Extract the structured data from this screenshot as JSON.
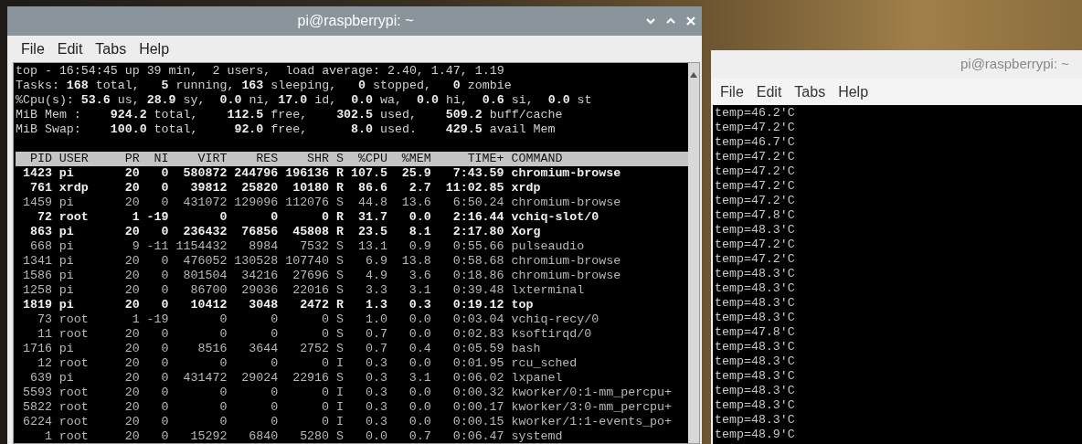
{
  "top_window": {
    "title": "pi@raspberrypi: ~",
    "active": true,
    "menu": [
      "File",
      "Edit",
      "Tabs",
      "Help"
    ],
    "summary_lines": [
      "top - 16:54:45 up 39 min,  2 users,  load average: 2.40, 1.47, 1.19",
      "Tasks: **168** total,   **5** running, **163** sleeping,   **0** stopped,   **0** zombie",
      "%Cpu(s): **53.6** us, **28.9** sy,  **0.0** ni, **17.0** id,  **0.0** wa,  **0.0** hi,  **0.6** si,  **0.0** st",
      "MiB Mem :    **924.2** total,    **112.5** free,    **302.5** used,    **509.2** buff/cache",
      "MiB Swap:    **100.0** total,     **92.0** free,      **8.0** used.    **429.5** avail Mem"
    ],
    "process_table": {
      "columns": [
        "PID",
        "USER",
        "PR",
        "NI",
        "VIRT",
        "RES",
        "SHR",
        "S",
        "%CPU",
        "%MEM",
        "TIME+",
        "COMMAND"
      ],
      "rows": [
        {
          "bold": true,
          "cells": [
            "1423",
            "pi",
            "20",
            "0",
            "580872",
            "244796",
            "196136",
            "R",
            "107.5",
            "25.9",
            "7:43.59",
            "chromium-browse"
          ]
        },
        {
          "bold": true,
          "cells": [
            "761",
            "xrdp",
            "20",
            "0",
            "39812",
            "25820",
            "10180",
            "R",
            "86.6",
            "2.7",
            "11:02.85",
            "xrdp"
          ]
        },
        {
          "bold": false,
          "cells": [
            "1459",
            "pi",
            "20",
            "0",
            "431072",
            "129096",
            "112076",
            "S",
            "44.8",
            "13.6",
            "6:50.24",
            "chromium-browse"
          ]
        },
        {
          "bold": true,
          "cells": [
            "72",
            "root",
            "1",
            "-19",
            "0",
            "0",
            "0",
            "R",
            "31.7",
            "0.0",
            "2:16.44",
            "vchiq-slot/0"
          ]
        },
        {
          "bold": true,
          "cells": [
            "863",
            "pi",
            "20",
            "0",
            "236432",
            "76856",
            "45808",
            "R",
            "23.5",
            "8.1",
            "2:17.80",
            "Xorg"
          ]
        },
        {
          "bold": false,
          "cells": [
            "668",
            "pi",
            "9",
            "-11",
            "1154432",
            "8984",
            "7532",
            "S",
            "13.1",
            "0.9",
            "0:55.66",
            "pulseaudio"
          ]
        },
        {
          "bold": false,
          "cells": [
            "1341",
            "pi",
            "20",
            "0",
            "476052",
            "130528",
            "107740",
            "S",
            "6.9",
            "13.8",
            "0:58.68",
            "chromium-browse"
          ]
        },
        {
          "bold": false,
          "cells": [
            "1586",
            "pi",
            "20",
            "0",
            "801504",
            "34216",
            "27696",
            "S",
            "4.9",
            "3.6",
            "0:18.86",
            "chromium-browse"
          ]
        },
        {
          "bold": false,
          "cells": [
            "1258",
            "pi",
            "20",
            "0",
            "86700",
            "29036",
            "22016",
            "S",
            "3.3",
            "3.1",
            "0:39.48",
            "lxterminal"
          ]
        },
        {
          "bold": true,
          "cells": [
            "1819",
            "pi",
            "20",
            "0",
            "10412",
            "3048",
            "2472",
            "R",
            "1.3",
            "0.3",
            "0:19.12",
            "top"
          ]
        },
        {
          "bold": false,
          "cells": [
            "73",
            "root",
            "1",
            "-19",
            "0",
            "0",
            "0",
            "S",
            "1.0",
            "0.0",
            "0:03.04",
            "vchiq-recy/0"
          ]
        },
        {
          "bold": false,
          "cells": [
            "11",
            "root",
            "20",
            "0",
            "0",
            "0",
            "0",
            "S",
            "0.7",
            "0.0",
            "0:02.83",
            "ksoftirqd/0"
          ]
        },
        {
          "bold": false,
          "cells": [
            "1716",
            "pi",
            "20",
            "0",
            "8516",
            "3644",
            "2752",
            "S",
            "0.7",
            "0.4",
            "0:05.59",
            "bash"
          ]
        },
        {
          "bold": false,
          "cells": [
            "12",
            "root",
            "20",
            "0",
            "0",
            "0",
            "0",
            "I",
            "0.3",
            "0.0",
            "0:01.95",
            "rcu_sched"
          ]
        },
        {
          "bold": false,
          "cells": [
            "639",
            "pi",
            "20",
            "0",
            "431472",
            "29024",
            "22916",
            "S",
            "0.3",
            "3.1",
            "0:06.02",
            "lxpanel"
          ]
        },
        {
          "bold": false,
          "cells": [
            "5593",
            "root",
            "20",
            "0",
            "0",
            "0",
            "0",
            "I",
            "0.3",
            "0.0",
            "0:00.32",
            "kworker/0:1-mm_percpu+"
          ]
        },
        {
          "bold": false,
          "cells": [
            "5822",
            "root",
            "20",
            "0",
            "0",
            "0",
            "0",
            "I",
            "0.3",
            "0.0",
            "0:00.17",
            "kworker/3:0-mm_percpu+"
          ]
        },
        {
          "bold": false,
          "cells": [
            "6224",
            "root",
            "20",
            "0",
            "0",
            "0",
            "0",
            "I",
            "0.3",
            "0.0",
            "0:00.15",
            "kworker/1:1-events_po+"
          ]
        },
        {
          "bold": false,
          "cells": [
            "1",
            "root",
            "20",
            "0",
            "15292",
            "6840",
            "5280",
            "S",
            "0.0",
            "0.7",
            "0:06.47",
            "systemd"
          ]
        }
      ]
    }
  },
  "temp_window": {
    "title": "pi@raspberrypi: ~",
    "active": false,
    "menu": [
      "File",
      "Edit",
      "Tabs",
      "Help"
    ],
    "lines": [
      "temp=46.2'C",
      "temp=47.2'C",
      "temp=46.7'C",
      "temp=47.2'C",
      "temp=47.2'C",
      "temp=47.2'C",
      "temp=47.2'C",
      "temp=47.8'C",
      "temp=48.3'C",
      "temp=47.2'C",
      "temp=47.2'C",
      "temp=48.3'C",
      "temp=48.3'C",
      "temp=48.3'C",
      "temp=48.3'C",
      "temp=47.8'C",
      "temp=48.3'C",
      "temp=48.3'C",
      "temp=48.3'C",
      "temp=48.3'C",
      "temp=48.3'C",
      "temp=48.3'C",
      "temp=48.9'C"
    ]
  }
}
